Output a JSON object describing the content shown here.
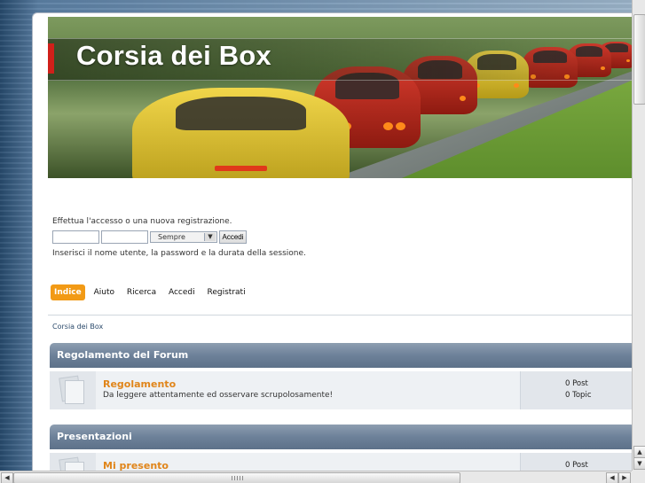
{
  "site": {
    "title": "Corsia dei Box"
  },
  "login": {
    "prompt": "Effettua l'accesso o una nuova registrazione.",
    "username_value": "",
    "password_value": "",
    "duration_selected": "Sempre",
    "submit_label": "Accedi",
    "hint": "Inserisci il nome utente, la password e la durata della sessione."
  },
  "nav": {
    "items": [
      {
        "label": "Indice",
        "active": true
      },
      {
        "label": "Aiuto",
        "active": false
      },
      {
        "label": "Ricerca",
        "active": false
      },
      {
        "label": "Accedi",
        "active": false
      },
      {
        "label": "Registrati",
        "active": false
      }
    ]
  },
  "breadcrumb": "Corsia dei Box",
  "categories": [
    {
      "title": "Regolamento del Forum",
      "forum": {
        "title": "Regolamento",
        "description": "Da leggere attentamente ed osservare scrupolosamente!",
        "posts": "0 Post",
        "topics": "0 Topic"
      }
    },
    {
      "title": "Presentazioni",
      "forum": {
        "title": "Mi presento",
        "description": "",
        "posts": "0 Post",
        "topics": ""
      }
    }
  ],
  "icons": {
    "scroll_up": "arrow-up-icon",
    "scroll_down": "arrow-down-icon",
    "scroll_left": "arrow-left-icon",
    "scroll_right": "arrow-right-icon",
    "forum": "forum-read-icon"
  },
  "colors": {
    "accent": "#f29a15",
    "forum_title": "#e0851a",
    "category_header": "#6d8199"
  }
}
